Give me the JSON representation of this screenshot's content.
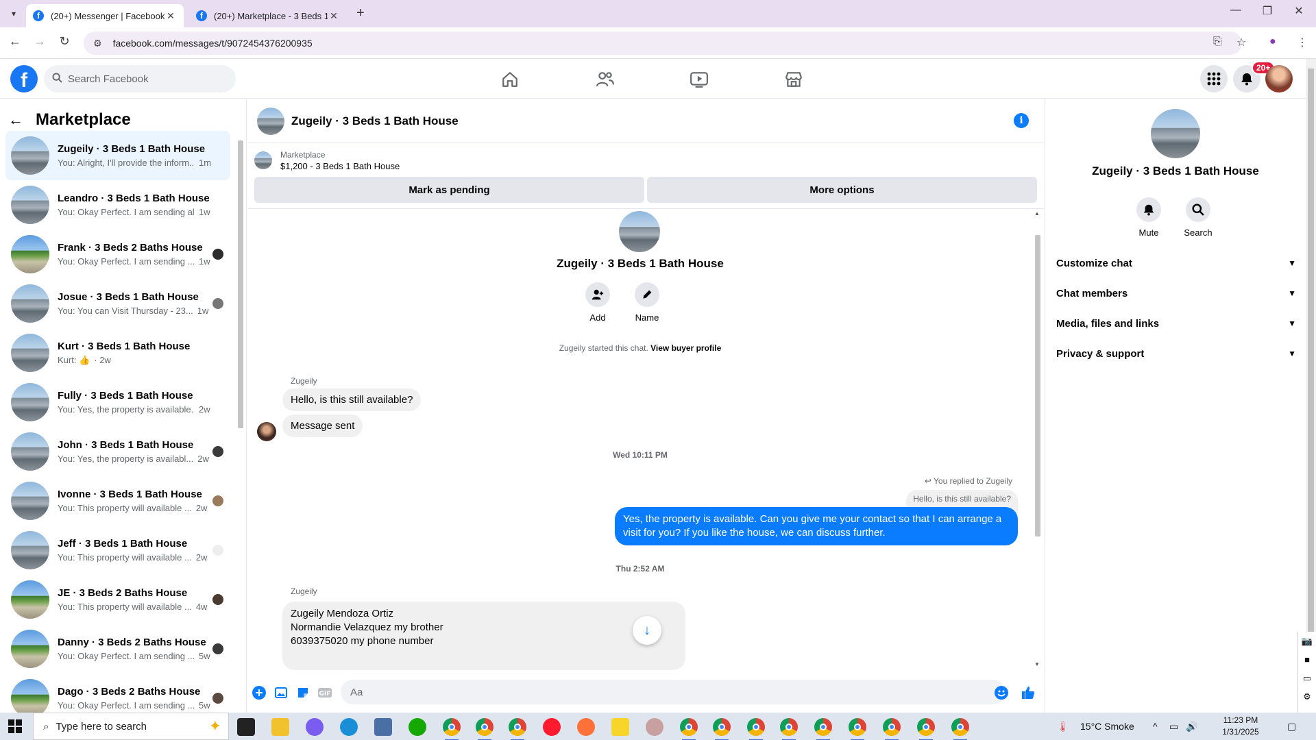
{
  "browser": {
    "tabs": [
      {
        "title": "(20+) Messenger | Facebook",
        "active": true
      },
      {
        "title": "(20+) Marketplace - 3 Beds 1 Ba",
        "active": false
      }
    ],
    "url": "facebook.com/messages/t/9072454376200935"
  },
  "fb_header": {
    "search_placeholder": "Search Facebook",
    "notification_badge": "20+"
  },
  "sidebar": {
    "title": "Marketplace",
    "conversations": [
      {
        "name": "Zugeily · 3 Beds 1 Bath House",
        "snippet": "You: Alright, I'll provide the inform...",
        "time": "1m",
        "thumb": "house1",
        "active": true
      },
      {
        "name": "Leandro · 3 Beds 1 Bath House",
        "snippet": "You: Okay Perfect. I am sending all ...",
        "time": "1w",
        "thumb": "house1"
      },
      {
        "name": "Frank · 3 Beds 2 Baths House",
        "snippet": "You: Okay Perfect. I am sending ...",
        "time": "1w",
        "thumb": "house2"
      },
      {
        "name": "Josue · 3 Beds 1 Bath House",
        "snippet": "You: You can Visit Thursday - 23...",
        "time": "1w",
        "thumb": "house1"
      },
      {
        "name": "Kurt · 3 Beds 1 Bath House",
        "snippet": "Kurt: 👍",
        "time": "· 2w",
        "thumb": "house1"
      },
      {
        "name": "Fully · 3 Beds 1 Bath House",
        "snippet": "You: Yes, the property is available. ...",
        "time": "2w",
        "thumb": "house1"
      },
      {
        "name": "John · 3 Beds 1 Bath House",
        "snippet": "You: Yes, the property is availabl...",
        "time": "2w",
        "thumb": "house1"
      },
      {
        "name": "Ivonne · 3 Beds 1 Bath House",
        "snippet": "You: This property will available ...",
        "time": "2w",
        "thumb": "house1"
      },
      {
        "name": "Jeff · 3 Beds 1 Bath House",
        "snippet": "You: This property will available ...",
        "time": "2w",
        "thumb": "house1"
      },
      {
        "name": "JE · 3 Beds 2 Baths House",
        "snippet": "You: This property will available ...",
        "time": "4w",
        "thumb": "house2"
      },
      {
        "name": "Danny · 3 Beds 2 Baths House",
        "snippet": "You: Okay Perfect. I am sending ...",
        "time": "5w",
        "thumb": "house2"
      },
      {
        "name": "Dago · 3 Beds 2 Baths House",
        "snippet": "You: Okay Perfect. I am sending ...",
        "time": "5w",
        "thumb": "house2"
      }
    ]
  },
  "chat": {
    "title": "Zugeily · 3 Beds 1 Bath House",
    "marketplace_label": "Marketplace",
    "listing": "$1,200 - 3 Beds 1 Bath House",
    "mark_pending": "Mark as pending",
    "more_options": "More options",
    "intro_name": "Zugeily · 3 Beds 1 Bath House",
    "add_label": "Add",
    "name_label": "Name",
    "started_text": "Zugeily started this chat.",
    "view_profile": "View buyer profile",
    "sender": "Zugeily",
    "msg1": "Hello, is this still available?",
    "msg2": "Message sent",
    "ts1": "Wed 10:11 PM",
    "replied_to": "You replied to Zugeily",
    "quoted": "Hello, is this still available?",
    "out_msg": "Yes, the property is available. Can you give me your contact so that I can arrange a visit for you? If you like the house, we can discuss further.",
    "ts2": "Thu 2:52 AM",
    "sender2": "Zugeily",
    "long_lines": [
      "Zugeily Mendoza Ortiz",
      "Normandie Velazquez my brother",
      "6039375020 my phone number"
    ],
    "composer_placeholder": "Aa"
  },
  "right_panel": {
    "name": "Zugeily · 3 Beds 1 Bath House",
    "mute": "Mute",
    "search": "Search",
    "sections": [
      "Customize chat",
      "Chat members",
      "Media, files and links",
      "Privacy & support"
    ]
  },
  "taskbar": {
    "search_placeholder": "Type here to search",
    "weather": "15°C  Smoke",
    "time": "11:23 PM",
    "date": "1/31/2025"
  },
  "colors": {
    "fb_blue": "#1877f2",
    "messenger_blue": "#0a7cff",
    "badge_red": "#e41e3f"
  }
}
